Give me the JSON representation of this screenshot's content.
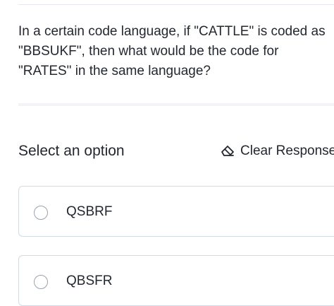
{
  "question": {
    "text": "In a certain code language, if \"CATTLE\" is coded as \"BBSUKF\", then what would be the code for \"RATES\" in the same language?"
  },
  "options_header": {
    "label": "Select an option",
    "clear_label": "Clear Response",
    "clear_icon": "eraser-icon"
  },
  "options": [
    {
      "label": "QSBRF"
    },
    {
      "label": "QBSFR"
    }
  ]
}
